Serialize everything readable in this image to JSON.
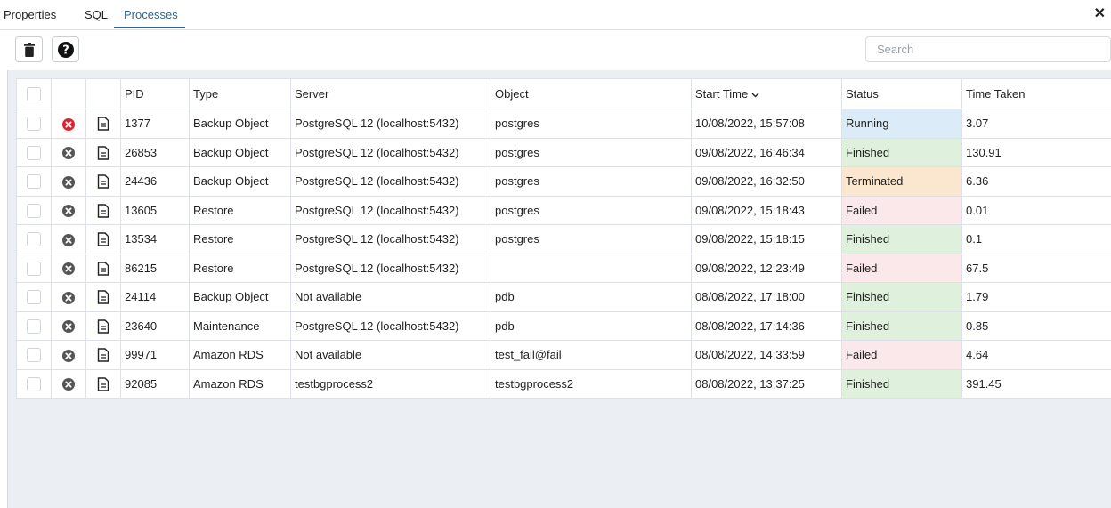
{
  "tabs": [
    "Properties",
    "SQL",
    "Processes"
  ],
  "active_tab": "Processes",
  "toolbar": {
    "delete_icon": "trash-icon",
    "help_icon": "help-icon",
    "search_placeholder": "Search"
  },
  "table": {
    "columns": [
      "PID",
      "Type",
      "Server",
      "Object",
      "Start Time",
      "Status",
      "Time Taken"
    ],
    "sort_column": "Start Time",
    "sort_direction": "descending",
    "rows": [
      {
        "pid": "1377",
        "type": "Backup Object",
        "server": "PostgreSQL 12 (localhost:5432)",
        "object": "postgres",
        "start": "10/08/2022, 15:57:08",
        "status": "Running",
        "time": "3.07"
      },
      {
        "pid": "26853",
        "type": "Backup Object",
        "server": "PostgreSQL 12 (localhost:5432)",
        "object": "postgres",
        "start": "09/08/2022, 16:46:34",
        "status": "Finished",
        "time": "130.91"
      },
      {
        "pid": "24436",
        "type": "Backup Object",
        "server": "PostgreSQL 12 (localhost:5432)",
        "object": "postgres",
        "start": "09/08/2022, 16:32:50",
        "status": "Terminated",
        "time": "6.36"
      },
      {
        "pid": "13605",
        "type": "Restore",
        "server": "PostgreSQL 12 (localhost:5432)",
        "object": "postgres",
        "start": "09/08/2022, 15:18:43",
        "status": "Failed",
        "time": "0.01"
      },
      {
        "pid": "13534",
        "type": "Restore",
        "server": "PostgreSQL 12 (localhost:5432)",
        "object": "postgres",
        "start": "09/08/2022, 15:18:15",
        "status": "Finished",
        "time": "0.1"
      },
      {
        "pid": "86215",
        "type": "Restore",
        "server": "PostgreSQL 12 (localhost:5432)",
        "object": "",
        "start": "09/08/2022, 12:23:49",
        "status": "Failed",
        "time": "67.5"
      },
      {
        "pid": "24114",
        "type": "Backup Object",
        "server": "Not available",
        "object": "pdb",
        "start": "08/08/2022, 17:18:00",
        "status": "Finished",
        "time": "1.79"
      },
      {
        "pid": "23640",
        "type": "Maintenance",
        "server": "PostgreSQL 12 (localhost:5432)",
        "object": "pdb",
        "start": "08/08/2022, 17:14:36",
        "status": "Finished",
        "time": "0.85"
      },
      {
        "pid": "99971",
        "type": "Amazon RDS",
        "server": "Not available",
        "object": "test_fail@fail",
        "start": "08/08/2022, 14:33:59",
        "status": "Failed",
        "time": "4.64"
      },
      {
        "pid": "92085",
        "type": "Amazon RDS",
        "server": "testbgprocess2",
        "object": "testbgprocess2",
        "start": "08/08/2022, 13:37:25",
        "status": "Finished",
        "time": "391.45"
      }
    ]
  },
  "colors": {
    "accent": "#326690",
    "running": "#dbebf8",
    "finished": "#dff0dc",
    "terminated": "#fbe7cf",
    "failed": "#fbe8ea",
    "stop_active": "#d9262e",
    "stop_inactive": "#555555"
  }
}
